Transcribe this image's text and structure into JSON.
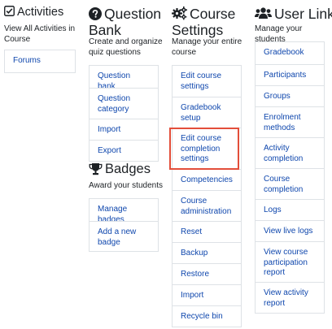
{
  "activities": {
    "title": "Activities",
    "description": "View All Activities in Course",
    "items": [
      "Forums"
    ]
  },
  "question_bank": {
    "title_line1": "Question",
    "title_line2": "Bank",
    "description": "Create and organize quiz questions",
    "items": [
      "Question bank",
      "Question category",
      "Import",
      "Export"
    ]
  },
  "badges": {
    "title": "Badges",
    "description": "Award your students",
    "items": [
      "Manage badges",
      "Add a new badge"
    ]
  },
  "course_settings": {
    "title_line1": "Course",
    "title_line2": "Settings",
    "description": "Manage your entire course",
    "items": [
      "Edit course settings",
      "Gradebook setup",
      "Edit course completion settings",
      "Competencies",
      "Course administration",
      "Reset",
      "Backup",
      "Restore",
      "Import",
      "Recycle bin"
    ]
  },
  "user_links": {
    "title": "User Links",
    "description": "Manage your students",
    "items": [
      "Gradebook",
      "Participants",
      "Groups",
      "Enrolment methods",
      "Activity completion",
      "Course completion",
      "Logs",
      "View live logs",
      "View course participation report",
      "View activity report"
    ]
  },
  "colors": {
    "link": "#0f47ad",
    "highlight": "#e34e3a",
    "border": "#dee2e6"
  },
  "icons": {
    "activities": "checkbox-icon",
    "question_bank": "question-circle-icon",
    "badges": "trophy-icon",
    "course_settings": "gears-icon",
    "user_links": "users-icon"
  }
}
